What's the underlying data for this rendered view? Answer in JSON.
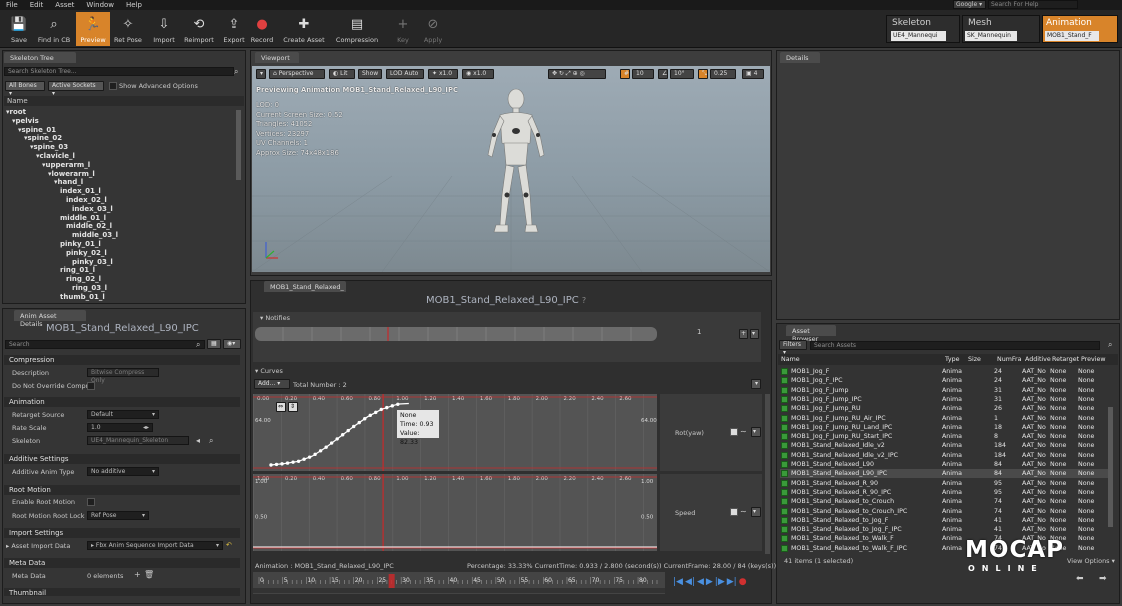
{
  "menu": [
    "File",
    "Edit",
    "Asset",
    "Window",
    "Help"
  ],
  "toolbar": [
    {
      "label": "Save",
      "icon": "save-icon",
      "glyph": "💾"
    },
    {
      "label": "Find in CB",
      "icon": "find-icon",
      "glyph": "⌕"
    },
    {
      "label": "Preview",
      "icon": "preview-icon",
      "glyph": "🏃",
      "active": true
    },
    {
      "label": "Ret Pose",
      "icon": "ret-pose-icon",
      "glyph": "✧"
    },
    {
      "label": "Import",
      "icon": "import-icon",
      "glyph": "⇩"
    },
    {
      "label": "Reimport",
      "icon": "reimport-icon",
      "glyph": "⟲"
    },
    {
      "label": "Export",
      "icon": "export-icon",
      "glyph": "⇪"
    },
    {
      "label": "Record",
      "icon": "record-icon",
      "glyph": "●"
    },
    {
      "label": "Create Asset",
      "icon": "create-asset-icon",
      "glyph": "✚"
    },
    {
      "label": "Compression",
      "icon": "compression-icon",
      "glyph": "▤"
    },
    {
      "label": "Key",
      "icon": "key-icon",
      "glyph": "+"
    },
    {
      "label": "Apply",
      "icon": "apply-icon",
      "glyph": "⊘"
    }
  ],
  "search_top": {
    "placeholder": "Search For Help",
    "engine": "Google"
  },
  "modes": [
    {
      "label": "Skeleton",
      "value": "UE4_Mannequi"
    },
    {
      "label": "Mesh",
      "value": "SK_Mannequin"
    },
    {
      "label": "Animation",
      "value": "MOB1_Stand_F",
      "active": true
    }
  ],
  "skeleton_tree": {
    "tab": "Skeleton Tree",
    "search_placeholder": "Search Skeleton Tree...",
    "bones_dropdown": "All Bones",
    "sockets_dropdown": "Active Sockets",
    "advanced": "Show Advanced Options",
    "column": "Name",
    "bones": [
      {
        "name": "root",
        "indent": 0
      },
      {
        "name": "pelvis",
        "indent": 1
      },
      {
        "name": "spine_01",
        "indent": 2
      },
      {
        "name": "spine_02",
        "indent": 3
      },
      {
        "name": "spine_03",
        "indent": 4
      },
      {
        "name": "clavicle_l",
        "indent": 5
      },
      {
        "name": "upperarm_l",
        "indent": 6
      },
      {
        "name": "lowerarm_l",
        "indent": 7
      },
      {
        "name": "hand_l",
        "indent": 8
      },
      {
        "name": "index_01_l",
        "indent": 9
      },
      {
        "name": "index_02_l",
        "indent": 10
      },
      {
        "name": "index_03_l",
        "indent": 11
      },
      {
        "name": "middle_01_l",
        "indent": 9
      },
      {
        "name": "middle_02_l",
        "indent": 10
      },
      {
        "name": "middle_03_l",
        "indent": 11
      },
      {
        "name": "pinky_01_l",
        "indent": 9
      },
      {
        "name": "pinky_02_l",
        "indent": 10
      },
      {
        "name": "pinky_03_l",
        "indent": 11
      },
      {
        "name": "ring_01_l",
        "indent": 9
      },
      {
        "name": "ring_02_l",
        "indent": 10
      },
      {
        "name": "ring_03_l",
        "indent": 11
      },
      {
        "name": "thumb_01_l",
        "indent": 9
      }
    ]
  },
  "anim_details": {
    "tab": "Anim Asset Details",
    "title": "MOB1_Stand_Relaxed_L90_IPC",
    "search_placeholder": "Search",
    "sections": {
      "compression": "Compression",
      "animation": "Animation",
      "additive": "Additive Settings",
      "root_motion": "Root Motion",
      "import": "Import Settings",
      "meta": "Meta Data",
      "thumbnail": "Thumbnail"
    },
    "props": {
      "description_label": "Description",
      "description_value": "Bitwise Compress Only",
      "no_override_label": "Do Not Override Compr",
      "retarget_label": "Retarget Source",
      "retarget_value": "Default",
      "rate_label": "Rate Scale",
      "rate_value": "1.0",
      "skeleton_label": "Skeleton",
      "skeleton_value": "UE4_Mannequin_Skeleton",
      "additive_type_label": "Additive Anim Type",
      "additive_type_value": "No additive",
      "enable_root_label": "Enable Root Motion",
      "root_lock_label": "Root Motion Root Lock",
      "root_lock_value": "Ref Pose",
      "asset_import_label": "Asset Import Data",
      "asset_import_value": "Fbx Anim Sequence Import Data",
      "meta_label": "Meta Data",
      "meta_value": "0 elements"
    }
  },
  "viewport": {
    "tab": "Viewport",
    "perspective": "Perspective",
    "lit": "Lit",
    "show": "Show",
    "lod": "LOD Auto",
    "speed1": "x1.0",
    "speed2": "x1.0",
    "grid": "10",
    "angle": "10°",
    "scale": "0.25",
    "cam": "4",
    "previewing": "Previewing Animation MOB1_Stand_Relaxed_L90_IPC",
    "stats": [
      "LOD: 0",
      "Current Screen Size: 0.52",
      "Triangles: 41052",
      "Vertices: 23297",
      "UV Channels: 1",
      "Approx Size: 74x48x186"
    ]
  },
  "details": {
    "tab": "Details"
  },
  "sequence": {
    "tab": "MOB1_Stand_Relaxed_",
    "title": "MOB1_Stand_Relaxed_L90_IPC",
    "notifies": "Notifies",
    "notify_track_num": "1",
    "curves": "Curves",
    "add": "Add...",
    "total": "Total Number : 2",
    "curve1": "Rot(yaw)",
    "curve2": "Speed",
    "tooltip": [
      "None",
      "Time: 0.93",
      "Value: 82.33"
    ],
    "curve1_ylabel": "64.00",
    "curve2_ylabels": [
      "1.00",
      "0.50"
    ],
    "curve1_xlabels": [
      "0.00",
      "0.20",
      "0.40",
      "0.60",
      "0.80",
      "1.00",
      "1.20",
      "1.40",
      "1.60",
      "1.80",
      "2.00",
      "2.20",
      "2.40",
      "2.60"
    ],
    "curve2_xlabels": [
      "1.00",
      "0.20",
      "0.40",
      "0.60",
      "0.80",
      "1.00",
      "1.20",
      "1.40",
      "1.60",
      "1.80",
      "2.00",
      "2.20",
      "2.40",
      "2.60"
    ],
    "status_anim": "Animation : MOB1_Stand_Relaxed_L90_IPC",
    "status_pct": "Percentage: 33.33% CurrentTime: 0.933 / 2.800 (second(s)) CurrentFrame: 28.00 / 84 (keys(s))",
    "timeline_ticks": [
      "0",
      "5",
      "10",
      "15",
      "20",
      "25",
      "30",
      "35",
      "40",
      "45",
      "50",
      "55",
      "60",
      "65",
      "70",
      "75",
      "80"
    ],
    "current_frame": 28,
    "total_frames": 84,
    "curve_points": [
      [
        0.0,
        0.0
      ],
      [
        0.1,
        2
      ],
      [
        0.2,
        5
      ],
      [
        0.3,
        12
      ],
      [
        0.4,
        24
      ],
      [
        0.5,
        38
      ],
      [
        0.6,
        52
      ],
      [
        0.7,
        65
      ],
      [
        0.8,
        75
      ],
      [
        0.9,
        81
      ],
      [
        0.93,
        82.33
      ],
      [
        1.0,
        83
      ]
    ]
  },
  "asset_browser": {
    "tab": "Asset Browser",
    "filters": "Filters",
    "search_placeholder": "Search Assets",
    "columns": [
      "Name",
      "Type",
      "Size",
      "NumFra",
      "Additive",
      "Retarget",
      "Preview"
    ],
    "rows": [
      [
        "MOB1_Jog_F",
        "Anima",
        "",
        "24",
        "AAT_No",
        "None",
        "None"
      ],
      [
        "MOB1_Jog_F_IPC",
        "Anima",
        "",
        "24",
        "AAT_No",
        "None",
        "None"
      ],
      [
        "MOB1_Jog_F_Jump",
        "Anima",
        "",
        "31",
        "AAT_No",
        "None",
        "None"
      ],
      [
        "MOB1_Jog_F_Jump_IPC",
        "Anima",
        "",
        "31",
        "AAT_No",
        "None",
        "None"
      ],
      [
        "MOB1_Jog_F_Jump_RU",
        "Anima",
        "",
        "26",
        "AAT_No",
        "None",
        "None"
      ],
      [
        "MOB1_Jog_F_Jump_RU_Air_IPC",
        "Anima",
        "",
        "1",
        "AAT_No",
        "None",
        "None"
      ],
      [
        "MOB1_Jog_F_Jump_RU_Land_IPC",
        "Anima",
        "",
        "18",
        "AAT_No",
        "None",
        "None"
      ],
      [
        "MOB1_Jog_F_Jump_RU_Start_IPC",
        "Anima",
        "",
        "8",
        "AAT_No",
        "None",
        "None"
      ],
      [
        "MOB1_Stand_Relaxed_Idle_v2",
        "Anima",
        "",
        "184",
        "AAT_No",
        "None",
        "None"
      ],
      [
        "MOB1_Stand_Relaxed_Idle_v2_IPC",
        "Anima",
        "",
        "184",
        "AAT_No",
        "None",
        "None"
      ],
      [
        "MOB1_Stand_Relaxed_L90",
        "Anima",
        "",
        "84",
        "AAT_No",
        "None",
        "None"
      ],
      [
        "MOB1_Stand_Relaxed_L90_IPC",
        "Anima",
        "",
        "84",
        "AAT_No",
        "None",
        "None"
      ],
      [
        "MOB1_Stand_Relaxed_R_90",
        "Anima",
        "",
        "95",
        "AAT_No",
        "None",
        "None"
      ],
      [
        "MOB1_Stand_Relaxed_R_90_IPC",
        "Anima",
        "",
        "95",
        "AAT_No",
        "None",
        "None"
      ],
      [
        "MOB1_Stand_Relaxed_to_Crouch",
        "Anima",
        "",
        "74",
        "AAT_No",
        "None",
        "None"
      ],
      [
        "MOB1_Stand_Relaxed_to_Crouch_IPC",
        "Anima",
        "",
        "74",
        "AAT_No",
        "None",
        "None"
      ],
      [
        "MOB1_Stand_Relaxed_to_Jog_F",
        "Anima",
        "",
        "41",
        "AAT_No",
        "None",
        "None"
      ],
      [
        "MOB1_Stand_Relaxed_to_Jog_F_IPC",
        "Anima",
        "",
        "41",
        "AAT_No",
        "None",
        "None"
      ],
      [
        "MOB1_Stand_Relaxed_to_Walk_F",
        "Anima",
        "",
        "74",
        "AAT_No",
        "None",
        "None"
      ],
      [
        "MOB1_Stand_Relaxed_to_Walk_F_IPC",
        "Anima",
        "",
        "74",
        "AAT_No",
        "None",
        "None"
      ]
    ],
    "selected_index": 11,
    "footer": "41 items (1 selected)",
    "view_options": "View Options"
  },
  "logo": {
    "main": "MOCAP",
    "sub": "ONLINE"
  },
  "colors": {
    "accent": "#d8842a",
    "curve_red": "#c8292a",
    "selected_row": "#4a4a4a"
  }
}
